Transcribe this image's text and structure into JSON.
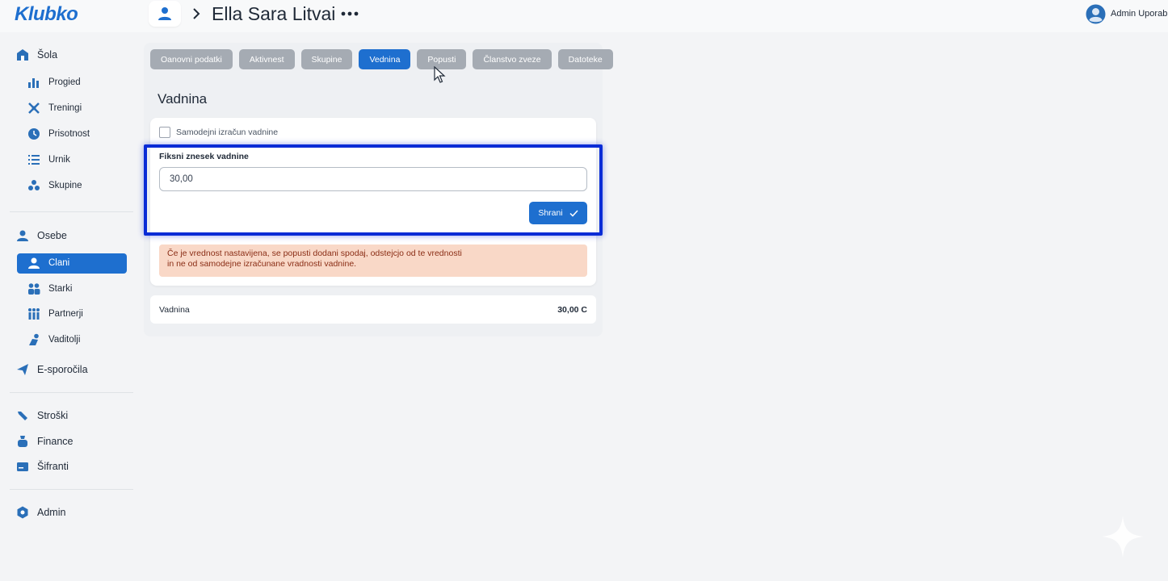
{
  "app": {
    "logo": "Klubko"
  },
  "header": {
    "title": "Ella Sara Litvai",
    "user_name": "Admin Uporabnik"
  },
  "sidebar": {
    "sections": [
      {
        "label": "Šola",
        "icon": "school-icon"
      },
      {
        "label": "Osebe",
        "icon": "person-icon"
      },
      {
        "label": "E-sporočila",
        "icon": "send-icon"
      },
      {
        "label": "Stroški",
        "icon": "wrench-icon"
      },
      {
        "label": "Finance",
        "icon": "money-icon"
      },
      {
        "label": "Šifranti",
        "icon": "card-icon"
      },
      {
        "label": "Admin",
        "icon": "gear-icon"
      }
    ],
    "school_items": [
      {
        "label": "Progied",
        "icon": "bar-chart-icon"
      },
      {
        "label": "Treningi",
        "icon": "training-icon"
      },
      {
        "label": "Prisotnost",
        "icon": "clock-icon"
      },
      {
        "label": "Urnik",
        "icon": "list-icon"
      },
      {
        "label": "Skupine",
        "icon": "group-icon"
      }
    ],
    "people_items": [
      {
        "label": "Clani",
        "icon": "member-icon",
        "active": true
      },
      {
        "label": "Starki",
        "icon": "parents-icon"
      },
      {
        "label": "Partnerji",
        "icon": "partners-icon"
      },
      {
        "label": "Vaditolji",
        "icon": "coach-icon"
      }
    ]
  },
  "tabs": [
    {
      "label": "Oanovni podatki",
      "active": false
    },
    {
      "label": "Aktivnest",
      "active": false
    },
    {
      "label": "Skupine",
      "active": false
    },
    {
      "label": "Vednina",
      "active": true
    },
    {
      "label": "Popusti",
      "active": false
    },
    {
      "label": "Članstvo zveze",
      "active": false
    },
    {
      "label": "Datoteke",
      "active": false
    }
  ],
  "section": {
    "title": "Vadnina",
    "auto_calc_label": "Samodejni izračun vadnine",
    "fixed_amount_label": "Fiksni znesek vadnine",
    "fixed_amount_value": "30,00",
    "save_label": "Shrani",
    "warning_line1": "Če je vrednost nastavijena, se popusti dodani spodaj, odstejcjo od te vrednosti",
    "warning_line2": "in ne od samodejne izračunane vradnosti vadnine."
  },
  "summary": {
    "label": "Vadnina",
    "value": "30,00 C"
  },
  "colors": {
    "accent": "#1e6fcf",
    "highlight": "#0a2cd6",
    "warning_bg": "#f9d8c7",
    "warning_text": "#8a2d15",
    "tab_inactive": "#a5abb3"
  }
}
